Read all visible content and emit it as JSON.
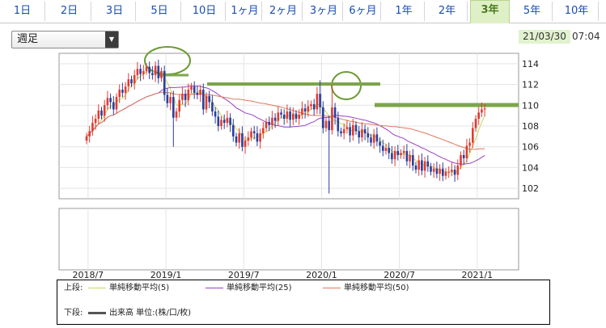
{
  "tabs": [
    {
      "label": "1日",
      "active": false
    },
    {
      "label": "2日",
      "active": false
    },
    {
      "label": "3日",
      "active": false
    },
    {
      "label": "5日",
      "active": false
    },
    {
      "label": "10日",
      "active": false
    },
    {
      "label": "1ヶ月",
      "active": false
    },
    {
      "label": "2ヶ月",
      "active": false
    },
    {
      "label": "3ヶ月",
      "active": false
    },
    {
      "label": "6ヶ月",
      "active": false
    },
    {
      "label": "1年",
      "active": false
    },
    {
      "label": "2年",
      "active": false
    },
    {
      "label": "3年",
      "active": true
    },
    {
      "label": "5年",
      "active": false
    },
    {
      "label": "10年",
      "active": false
    }
  ],
  "period_select": {
    "value": "週足"
  },
  "as_of": {
    "date": "21/03/30",
    "time": "07:04"
  },
  "legend": {
    "upper_label": "上段:",
    "lower_label": "下段:",
    "items": [
      {
        "label": "単純移動平均(5)",
        "color": "#c7d85a"
      },
      {
        "label": "単純移動平均(25)",
        "color": "#9b3fc4"
      },
      {
        "label": "単純移動平均(50)",
        "color": "#e0785a"
      }
    ],
    "volume_label": "出来高 単位:(株/口/枚)",
    "volume_color": "#555555"
  },
  "chart_data": {
    "type": "candlestick",
    "x_ticks": [
      "2018/7",
      "2019/1",
      "2019/7",
      "2020/1",
      "2020/7",
      "2021/1"
    ],
    "y_ticks": [
      102,
      104,
      106,
      108,
      110,
      112,
      114
    ],
    "ylim": [
      101,
      115
    ],
    "up_color": "#e03c31",
    "down_color": "#2a3f9e",
    "x_tick_positions": [
      0.5,
      26.5,
      52.5,
      78.5,
      104.5,
      130.5
    ],
    "closes": [
      107.0,
      107.5,
      108.3,
      108.7,
      109.5,
      109.0,
      110.0,
      110.7,
      110.3,
      109.6,
      110.8,
      111.5,
      111.2,
      111.8,
      112.5,
      112.1,
      112.9,
      113.5,
      113.0,
      113.3,
      113.7,
      113.1,
      112.9,
      113.8,
      112.6,
      113.3,
      111.0,
      110.2,
      110.8,
      108.8,
      109.4,
      110.5,
      111.1,
      110.5,
      111.5,
      111.8,
      111.2,
      111.0,
      111.5,
      109.6,
      110.9,
      110.3,
      109.4,
      108.9,
      108.0,
      108.6,
      108.3,
      108.8,
      108.1,
      107.0,
      106.4,
      107.3,
      106.0,
      106.6,
      106.9,
      107.5,
      107.3,
      106.5,
      107.3,
      107.8,
      108.4,
      108.1,
      108.8,
      108.5,
      109.3,
      109.1,
      108.7,
      109.4,
      108.6,
      109.2,
      108.7,
      109.1,
      109.7,
      109.4,
      109.9,
      110.1,
      109.6,
      111.1,
      109.8,
      107.8,
      108.5,
      107.6,
      109.8,
      108.8,
      107.5,
      107.3,
      107.7,
      107.9,
      107.1,
      108.1,
      107.5,
      106.9,
      107.7,
      107.3,
      106.9,
      106.4,
      107.2,
      106.5,
      106.1,
      105.6,
      105.9,
      105.4,
      104.8,
      105.6,
      105.2,
      105.4,
      105.6,
      104.6,
      105.2,
      104.2,
      103.8,
      104.7,
      103.7,
      104.6,
      104.1,
      103.6,
      103.9,
      103.4,
      103.9,
      103.2,
      103.6,
      103.6,
      103.8,
      103.3,
      104.2,
      105.2,
      104.9,
      106.1,
      106.4,
      107.8,
      108.7,
      109.3,
      109.6,
      109.7
    ]
  }
}
